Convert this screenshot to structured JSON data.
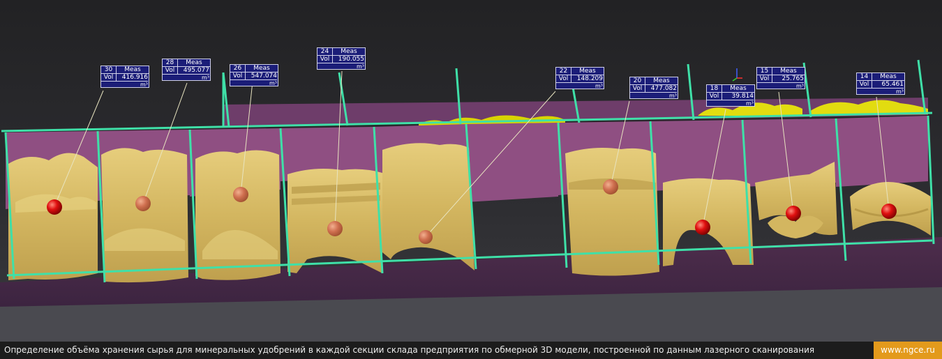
{
  "caption": {
    "text": "Определение объёма хранения сырья для минеральных удобрений в каждой секции склада предприятия по обмерной 3D модели, построенной по данным лазерного сканирования",
    "site": "www.ngce.ru"
  },
  "colors": {
    "background": "#2a2a2d",
    "wall": "#8a4e7e",
    "floor": "#4a2a48",
    "material": "#d8bc68",
    "frame": "#3fe0a8",
    "marker": "#e00000",
    "tag_fill": "#1b1d78",
    "caption_bg": "#1c1c1c",
    "badge": "#e39a1c"
  },
  "measurements": [
    {
      "id": "30",
      "header": "Meas",
      "label": "Vol",
      "value": "416.916",
      "unit": "m³"
    },
    {
      "id": "28",
      "header": "Meas",
      "label": "Vol",
      "value": "495.077",
      "unit": "m³"
    },
    {
      "id": "26",
      "header": "Meas",
      "label": "Vol",
      "value": "547.074",
      "unit": "m³"
    },
    {
      "id": "24",
      "header": "Meas",
      "label": "Vol",
      "value": "190.055",
      "unit": "m³"
    },
    {
      "id": "22",
      "header": "Meas",
      "label": "Vol",
      "value": "148.209",
      "unit": "m³"
    },
    {
      "id": "20",
      "header": "Meas",
      "label": "Vol",
      "value": "477.082",
      "unit": "m³"
    },
    {
      "id": "18",
      "header": "Meas",
      "label": "Vol",
      "value": "39.814",
      "unit": "m³"
    },
    {
      "id": "15",
      "header": "Meas",
      "label": "Vol",
      "value": "25.765",
      "unit": "m³"
    },
    {
      "id": "14",
      "header": "Meas",
      "label": "Vol",
      "value": "65.461",
      "unit": "m³"
    }
  ]
}
